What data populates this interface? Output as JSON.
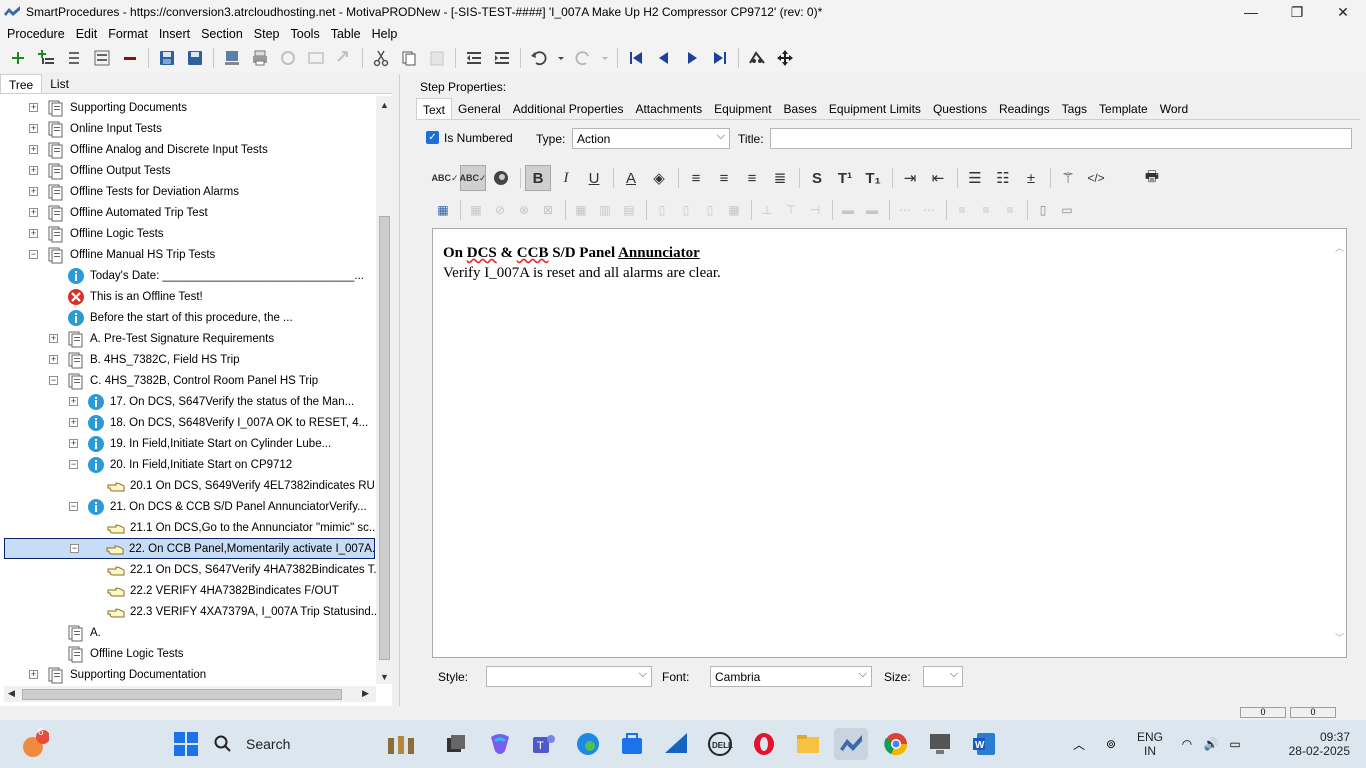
{
  "window": {
    "title": "SmartProcedures - https://conversion3.atrcloudhosting.net - MotivaPRODNew - [-SIS-TEST-####] 'I_007A Make Up H2 Compressor CP9712' (rev: 0)*",
    "minimize": "—",
    "restore": "❐",
    "close": "✕"
  },
  "menu": [
    "Procedure",
    "Edit",
    "Format",
    "Insert",
    "Section",
    "Step",
    "Tools",
    "Table",
    "Help"
  ],
  "left_tabs": [
    "Tree",
    "List"
  ],
  "tree": [
    {
      "label": "Supporting Documents",
      "exp": "+",
      "icon": "doc",
      "indent": 0
    },
    {
      "label": "Online Input Tests",
      "exp": "+",
      "icon": "doc",
      "indent": 0
    },
    {
      "label": "Offline Analog and Discrete Input Tests",
      "exp": "+",
      "icon": "doc",
      "indent": 0
    },
    {
      "label": "Offline Output Tests",
      "exp": "+",
      "icon": "doc",
      "indent": 0
    },
    {
      "label": "Offline Tests for Deviation Alarms",
      "exp": "+",
      "icon": "doc",
      "indent": 0
    },
    {
      "label": "Offline Automated Trip Test",
      "exp": "+",
      "icon": "doc",
      "indent": 0
    },
    {
      "label": "Offline Logic Tests",
      "exp": "+",
      "icon": "doc",
      "indent": 0
    },
    {
      "label": "Offline Manual HS Trip Tests",
      "exp": "−",
      "icon": "doc",
      "indent": 0
    },
    {
      "label": "Today's Date: ______________________________...",
      "exp": "",
      "icon": "info",
      "indent": 1
    },
    {
      "label": "This is an Offline Test!",
      "exp": "",
      "icon": "error",
      "indent": 1
    },
    {
      "label": "Before the start of this procedure, the ...",
      "exp": "",
      "icon": "info",
      "indent": 1
    },
    {
      "label": "A. Pre-Test Signature Requirements",
      "exp": "+",
      "icon": "doc",
      "indent": 1
    },
    {
      "label": "B. 4HS_7382C, Field HS Trip",
      "exp": "+",
      "icon": "doc",
      "indent": 1
    },
    {
      "label": "C. 4HS_7382B, Control Room Panel HS Trip",
      "exp": "−",
      "icon": "doc",
      "indent": 1
    },
    {
      "label": "17. On DCS, S647Verify the status of the Man...",
      "exp": "+",
      "icon": "info",
      "indent": 2
    },
    {
      "label": "18. On DCS, S648Verify I_007A OK to RESET, 4...",
      "exp": "+",
      "icon": "info",
      "indent": 2
    },
    {
      "label": "19. In Field,Initiate Start on Cylinder Lube...",
      "exp": "+",
      "icon": "info",
      "indent": 2
    },
    {
      "label": "20. In Field,Initiate Start on CP9712",
      "exp": "−",
      "icon": "info",
      "indent": 2
    },
    {
      "label": "20.1 On DCS, S649Verify 4EL7382indicates RU...",
      "exp": "",
      "icon": "hand",
      "indent": 3
    },
    {
      "label": "21. On DCS & CCB S/D Panel AnnunciatorVerify...",
      "exp": "−",
      "icon": "info",
      "indent": 2
    },
    {
      "label": "21.1 On DCS,Go to the Annunciator \"mimic\" sc...",
      "exp": "",
      "icon": "hand",
      "indent": 3
    },
    {
      "label": "22. On CCB Panel,Momentarily activate I_007A...",
      "exp": "−",
      "icon": "hand",
      "indent": 2,
      "selected": true
    },
    {
      "label": "22.1 On DCS, S647Verify 4HA7382Bindicates T...",
      "exp": "",
      "icon": "hand",
      "indent": 3
    },
    {
      "label": "22.2 VERIFY 4HA7382Bindicates F/OUT",
      "exp": "",
      "icon": "hand",
      "indent": 3
    },
    {
      "label": "22.3 VERIFY 4XA7379A, I_007A Trip Statusind...",
      "exp": "",
      "icon": "hand",
      "indent": 3
    },
    {
      "label": "A.",
      "exp": "",
      "icon": "doc",
      "indent": 1
    },
    {
      "label": "Offline Logic Tests",
      "exp": "",
      "icon": "doc",
      "indent": 1
    },
    {
      "label": "Supporting Documentation",
      "exp": "+",
      "icon": "doc",
      "indent": 0
    }
  ],
  "step_properties": {
    "heading": "Step Properties:",
    "tabs": [
      "Text",
      "General",
      "Additional Properties",
      "Attachments",
      "Equipment",
      "Bases",
      "Equipment Limits",
      "Questions",
      "Readings",
      "Tags",
      "Template",
      "Word"
    ],
    "is_numbered_label": "Is Numbered",
    "type_label": "Type:",
    "type_value": "Action",
    "title_label": "Title:",
    "title_value": ""
  },
  "editor": {
    "line1_part1": "On ",
    "line1_dcs": "DCS",
    "line1_part2": " & ",
    "line1_ccb": "CCB",
    "line1_part3": " S/D Panel ",
    "line1_ann": "Annunciator",
    "line2": "Verify I_007A is reset and all alarms are clear."
  },
  "bottom": {
    "style_label": "Style:",
    "style_value": "",
    "font_label": "Font:",
    "font_value": "Cambria",
    "size_label": "Size:",
    "size_value": ""
  },
  "status": {
    "cell1": "0",
    "cell2": "0"
  },
  "taskbar": {
    "search": "Search",
    "weather_badge": "6",
    "lang1": "ENG",
    "lang2": "IN",
    "time": "09:37",
    "date": "28-02-2025"
  },
  "colors": {
    "selection": "#c7dcf5",
    "accent": "#1d6fd6",
    "taskbar": "#dce6ef"
  }
}
